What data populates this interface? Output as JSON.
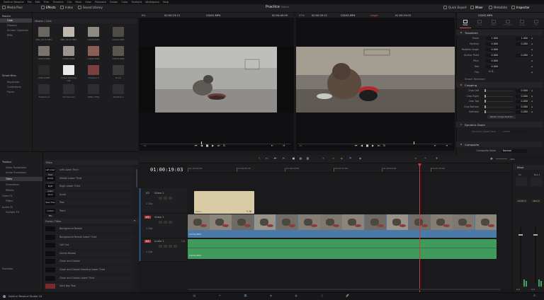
{
  "menu": [
    "DaVinci Resolve",
    "File",
    "Edit",
    "Trim",
    "Timeline",
    "Clip",
    "Mark",
    "View",
    "Playback",
    "Fusion",
    "Color",
    "Fairlight",
    "Workspace",
    "Help"
  ],
  "toolbar": {
    "media_pool": "Media Pool",
    "effects": "Effects",
    "index": "Index",
    "sound_library": "Sound Library",
    "project_title": "Practice",
    "project_status": "Edited",
    "quick_export": "Quick Export",
    "mixer": "Mixer",
    "metadata": "Metadata",
    "inspector": "Inspector"
  },
  "viewer_header": {
    "left_zoom": "8%",
    "left_timecode": "00:00:23:13",
    "left_clip": "C0241.MP4",
    "left_duration": "00:04:40:09",
    "right_zoom": "27%",
    "right_timecode": "00:00:25:12",
    "right_clip": "C0242.MP4",
    "right_timeline": "single",
    "right_tc2": "01:00:19:03",
    "inspector_clip": "C0242.MP4"
  },
  "bins": {
    "master": "Master",
    "items": [
      "Cats",
      "Flowers",
      "Screen Captures",
      "BRIs"
    ],
    "smart_bins": "Smart Bins",
    "smart_items": [
      "Keywords",
      "Collections",
      "Faces"
    ]
  },
  "media_pool": {
    "path": "Master / Cats",
    "thumbs": [
      {
        "name": "IMG_0113.HEIC",
        "bg": "#6b6660"
      },
      {
        "name": "IMG_0114.HEIC",
        "bg": "#bdb7ad"
      },
      {
        "name": "C0238.MP4",
        "bg": "#8f8a82"
      },
      {
        "name": "C0242.MP4",
        "bg": "#4f4c48"
      },
      {
        "name": "C0239.MP4",
        "bg": "#7a756c"
      },
      {
        "name": "C0241.MP4",
        "bg": "#9a9590"
      },
      {
        "name": "C0242.MP4",
        "bg": "#8c5e58"
      },
      {
        "name": "C0243.MP4",
        "bg": "#5a5650"
      },
      {
        "name": "C0244.MP4",
        "bg": "#2a2a2a"
      },
      {
        "name": "Cross Tracking Cat",
        "bg": "#e8e8e8"
      },
      {
        "name": "Timeline 3",
        "bg": "#7a3f3f"
      },
      {
        "name": "Zoop",
        "bg": "#3a3a3a"
      },
      {
        "name": "Timeline 2",
        "bg": "#2e2e30"
      },
      {
        "name": "Vid Sources",
        "bg": "#2e2e30"
      },
      {
        "name": "Kitten Tiltg",
        "bg": "#2e2e30"
      },
      {
        "name": "Timeline 1",
        "bg": "#2e2e30"
      }
    ]
  },
  "effects": {
    "toolbox": "Toolbox",
    "tree": [
      "Video Transitions",
      "Audio Transitions",
      "Titles",
      "Generators",
      "Effects",
      "Open FX",
      "Filters",
      "Audio FX",
      "Fairlight FX",
      "Favorites"
    ],
    "titles_header": "Titles",
    "titles": [
      {
        "thumb": "Left Lower Third",
        "label": "Left Lower Third"
      },
      {
        "thumb": "Middle Lower Third",
        "label": "Middle Lower Third"
      },
      {
        "thumb": "Right Lower Third",
        "label": "Right Lower Third"
      },
      {
        "thumb": "Scroll",
        "label": "Scroll"
      },
      {
        "thumb": "Basic Title",
        "label": "Text"
      },
      {
        "thumb": "Custom Title",
        "label": "Text+"
      }
    ],
    "fusion_header": "Fusion Titles",
    "fusion": [
      "Background Reveal",
      "Background Reveal Lower Third",
      "Call Out",
      "Center Reveal",
      "Clean and Simple",
      "Clean and Simple Heading Lower Third",
      "Clean and Simple Lower Third",
      "Dark Box Text"
    ]
  },
  "inspector": {
    "tabs": [
      "Video",
      "Audio",
      "Effect",
      "Transition",
      "Image",
      "File"
    ],
    "transform": "Transform",
    "rows": [
      {
        "label": "Zoom",
        "x": "1.000",
        "y": "1.000"
      },
      {
        "label": "Position",
        "x": "0.000",
        "y": "0.000"
      },
      {
        "label": "Rotation Angle",
        "x": "0.000",
        "y": ""
      },
      {
        "label": "Anchor Point",
        "x": "0.000",
        "y": "0.000"
      },
      {
        "label": "Pitch",
        "x": "0.000",
        "y": ""
      },
      {
        "label": "Yaw",
        "x": "0.000",
        "y": ""
      },
      {
        "label": "Flip",
        "x": "",
        "y": ""
      }
    ],
    "smart_reframe": "Smart Reframe",
    "cropping": "Cropping",
    "crop_rows": [
      {
        "label": "Crop Left",
        "value": "0.000"
      },
      {
        "label": "Crop Right",
        "value": "0.000"
      },
      {
        "label": "Crop Top",
        "value": "0.000"
      },
      {
        "label": "Crop Bottom",
        "value": "0.000"
      },
      {
        "label": "Softness",
        "value": "0.000"
      }
    ],
    "retain_image_position": "Retain Image Position",
    "dynamic_zoom": "Dynamic Zoom",
    "dz_ease_label": "Dynamic Zoom Ease",
    "dz_ease_value": "Linear",
    "composite": "Composite",
    "composite_mode_label": "Composite Mode",
    "composite_mode_value": "Normal"
  },
  "timeline": {
    "timecode": "01:00:19:03",
    "ruler": [
      "01:00:00:00",
      "01:00:05:00",
      "01:00:10:00",
      "01:00:15:00",
      "01:00:20:00",
      "01:00:25:00"
    ],
    "tracks": [
      {
        "id": "V2",
        "name": "Video 2",
        "count": "1 Clip"
      },
      {
        "id": "V1",
        "name": "Video 1",
        "count": "1 Clip"
      },
      {
        "id": "A1",
        "name": "Audio 1",
        "count": "1 Clip",
        "level": "2.0"
      }
    ],
    "v1_clip": "C0242.MP4",
    "a1_clip": "C0242.MP4",
    "v2_clip": "Text+",
    "zoom_value": "-10%"
  },
  "mixer": {
    "title": "Mixer",
    "channels": [
      "A1",
      "Bus 1"
    ],
    "levels": [
      "0.0",
      "0.0"
    ],
    "labels": [
      "Audio 1",
      "Bus 1"
    ]
  },
  "status": {
    "app": "DaVinci Resolve Studio 18"
  },
  "colors": {
    "accent_red": "#e0574f",
    "playhead": "#d23a3a",
    "video_clip": "#4c7aa8",
    "audio_clip": "#3f9a5c",
    "title_clip": "#d8cba6"
  }
}
